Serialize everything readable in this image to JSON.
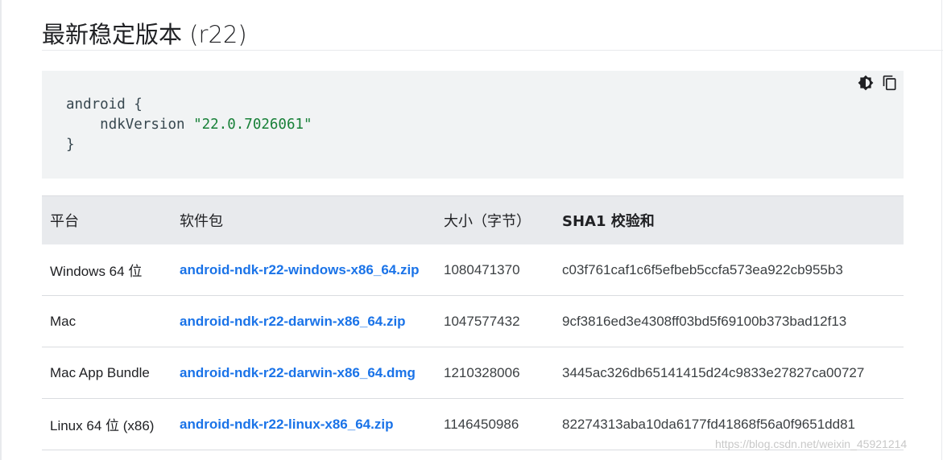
{
  "section": {
    "title": "最新稳定版本 (r22)"
  },
  "code": {
    "line1": "android {",
    "line2_key": "ndkVersion ",
    "line2_value": "\"22.0.7026061\"",
    "line3": "}",
    "tools": [
      "dark-theme-icon",
      "copy-icon"
    ]
  },
  "table": {
    "headers": {
      "platform": "平台",
      "package": "软件包",
      "size": "大小（字节）",
      "sha1": "SHA1 校验和"
    },
    "rows": [
      {
        "platform": "Windows 64 位",
        "package": "android-ndk-r22-windows-x86_64.zip",
        "size": "1080471370",
        "sha1": "c03f761caf1c6f5efbeb5ccfa573ea922cb955b3"
      },
      {
        "platform": "Mac",
        "package": "android-ndk-r22-darwin-x86_64.zip",
        "size": "1047577432",
        "sha1": "9cf3816ed3e4308ff03bd5f69100b373bad12f13"
      },
      {
        "platform": "Mac App Bundle",
        "package": "android-ndk-r22-darwin-x86_64.dmg",
        "size": "1210328006",
        "sha1": "3445ac326db65141415d24c9833e27827ca00727"
      },
      {
        "platform": "Linux 64 位 (x86)",
        "package": "android-ndk-r22-linux-x86_64.zip",
        "size": "1146450986",
        "sha1": "82274313aba10da6177fd41868f56a0f9651dd81"
      }
    ]
  },
  "watermark": "https://blog.csdn.net/weixin_45921214",
  "colors": {
    "link": "#1a73e8",
    "string": "#188038",
    "code_bg": "#f1f3f4",
    "header_bg": "#e8eaed"
  }
}
